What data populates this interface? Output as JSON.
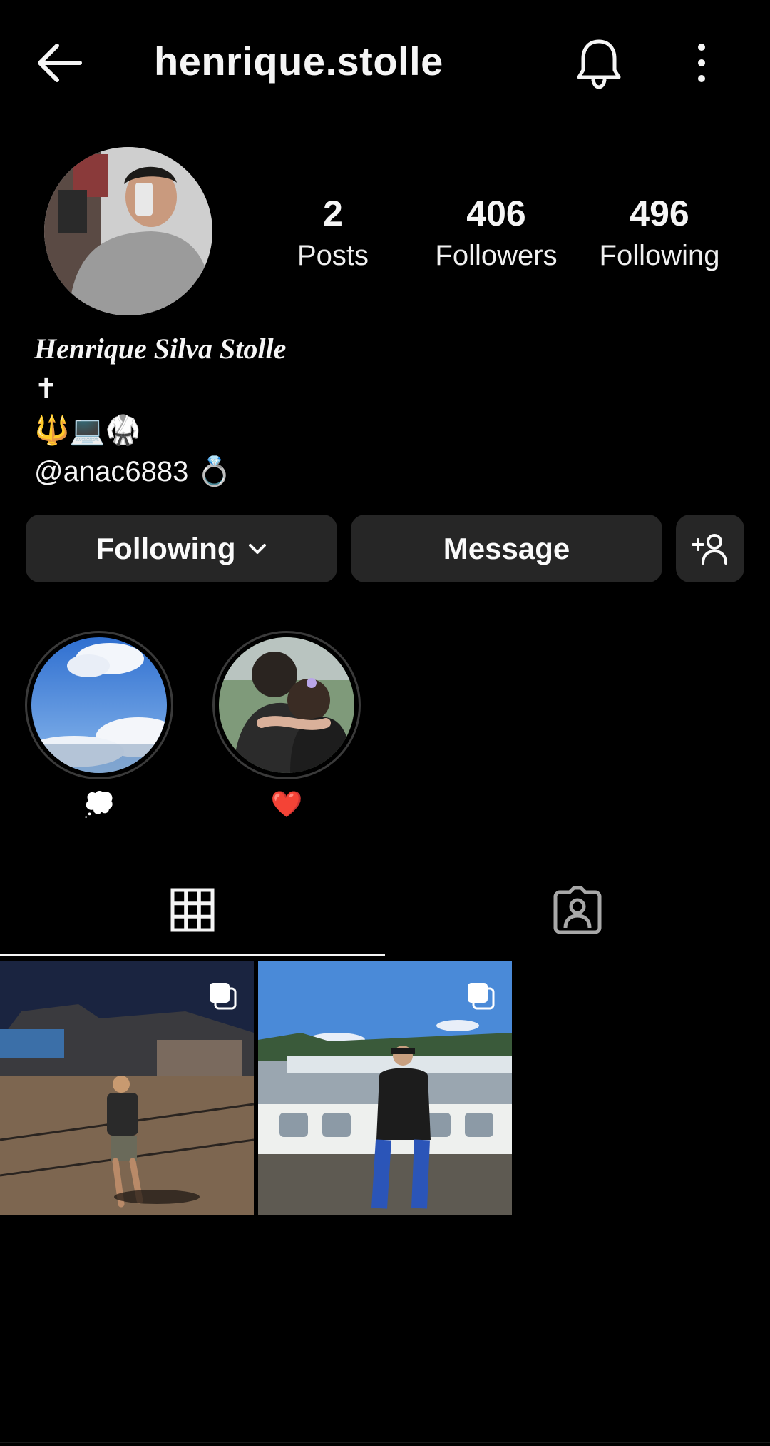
{
  "header": {
    "username": "henrique.stolle",
    "back_icon": "arrow-left-icon",
    "bell_icon": "bell-icon",
    "more_icon": "more-vertical-icon"
  },
  "profile": {
    "avatar": "profile-photo",
    "stats": [
      {
        "value": "2",
        "label": "Posts"
      },
      {
        "value": "406",
        "label": "Followers"
      },
      {
        "value": "496",
        "label": "Following"
      }
    ],
    "full_name": "Henrique Silva Stolle",
    "bio_line1": "✝",
    "bio_line2": "🔱💻🥋",
    "bio_mention": "@anac6883 💍"
  },
  "actions": {
    "following_label": "Following",
    "message_label": "Message",
    "add_user_icon": "add-person-icon"
  },
  "highlights": [
    {
      "label": "💭"
    },
    {
      "label": "❤️"
    }
  ],
  "tabs": {
    "grid_icon": "grid-icon",
    "tagged_icon": "tagged-person-icon"
  },
  "colors": {
    "background": "#000000",
    "button": "#262626",
    "text": "#f5f5f5"
  }
}
